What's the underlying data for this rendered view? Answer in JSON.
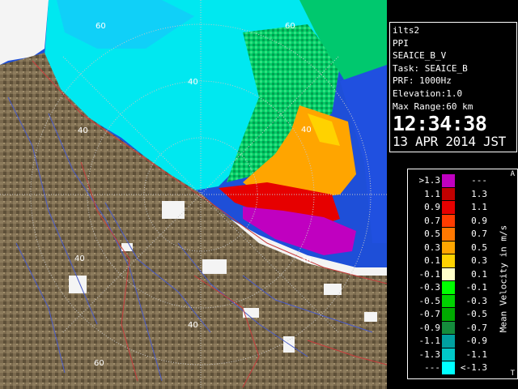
{
  "info": {
    "station": "ilts2",
    "mode": "PPI",
    "volume": "SEAICE_B_V",
    "task": "Task: SEAICE_B",
    "prf": "PRF: 1000Hz",
    "elevation": "Elevation:1.0",
    "max_range": "Max Range:60 km",
    "time": "12:34:38",
    "date": "13 APR 2014 JST"
  },
  "legend": {
    "title": "Mean Velocity in m/s",
    "corner_top": "A",
    "corner_bottom": "T",
    "rows": [
      {
        "low": ">1.3",
        "high": "---",
        "color": "#c000c0"
      },
      {
        "low": "1.1",
        "high": "1.3",
        "color": "#c00000"
      },
      {
        "low": "0.9",
        "high": "1.1",
        "color": "#e60000"
      },
      {
        "low": "0.7",
        "high": "0.9",
        "color": "#ff3c00"
      },
      {
        "low": "0.5",
        "high": "0.7",
        "color": "#ff7800"
      },
      {
        "low": "0.3",
        "high": "0.5",
        "color": "#ffa500"
      },
      {
        "low": "0.1",
        "high": "0.3",
        "color": "#ffd200"
      },
      {
        "low": "-0.1",
        "high": "0.1",
        "color": "#ffffc8"
      },
      {
        "low": "-0.3",
        "high": "-0.1",
        "color": "#00ff00"
      },
      {
        "low": "-0.5",
        "high": "-0.3",
        "color": "#00d200"
      },
      {
        "low": "-0.7",
        "high": "-0.5",
        "color": "#00aa00"
      },
      {
        "low": "-0.9",
        "high": "-0.7",
        "color": "#148c3c"
      },
      {
        "low": "-1.1",
        "high": "-0.9",
        "color": "#00a0a0"
      },
      {
        "low": "-1.3",
        "high": "-1.1",
        "color": "#00c8c8"
      },
      {
        "low": "---",
        "high": "<-1.3",
        "color": "#00ffff"
      }
    ]
  },
  "radar": {
    "range_labels": [
      "40",
      "60",
      "40",
      "60",
      "40",
      "40",
      "40",
      "60"
    ],
    "colors": {
      "land": "#7b6a4e",
      "sea": "#00ffff",
      "sky": "#1e4fd8",
      "snow": "#f4f4f4",
      "range_ring": "#c8c8c8"
    }
  }
}
